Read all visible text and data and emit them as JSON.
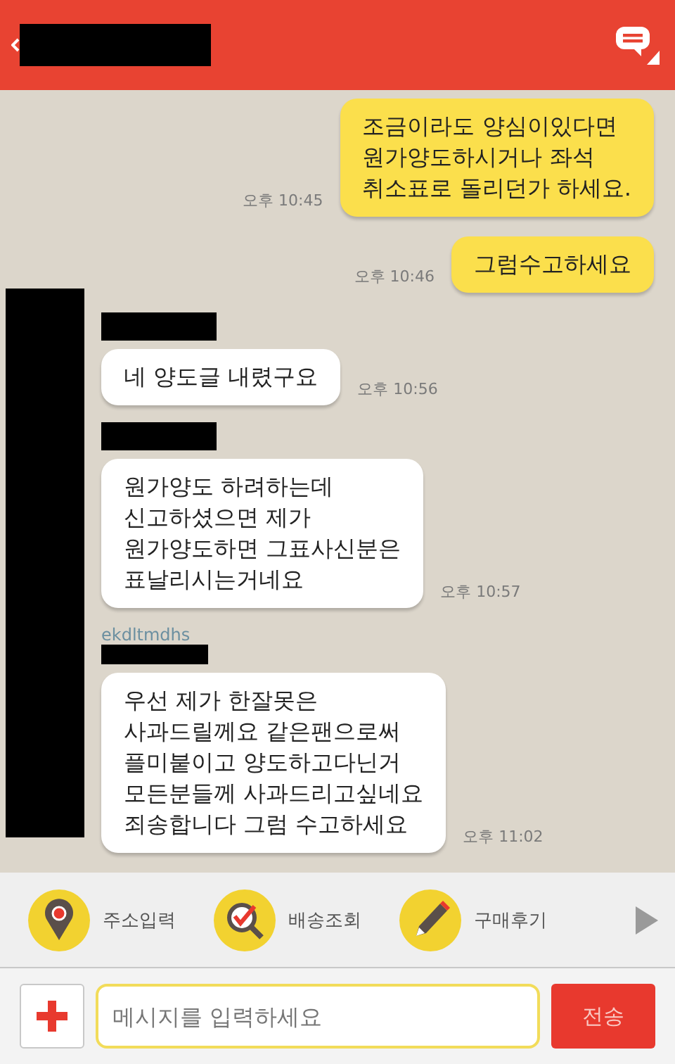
{
  "header": {
    "title_redacted": true
  },
  "chat": {
    "side_redacted": true,
    "messages": [
      {
        "kind": "outgoing",
        "lines": [
          "조금이라도 양심이있다면",
          "원가양도하시거나 좌석",
          "취소표로 돌리던가 하세요."
        ],
        "time": "오후 10:45"
      },
      {
        "kind": "outgoing",
        "lines": [
          "그럼수고하세요"
        ],
        "time": "오후 10:46"
      },
      {
        "kind": "incoming",
        "sender_redacted": true,
        "lines": [
          "네 양도글 내렸구요"
        ],
        "time": "오후 10:56"
      },
      {
        "kind": "incoming",
        "sender_redacted": true,
        "lines": [
          "원가양도 하려하는데",
          "신고하셨으면 제가",
          "원가양도하면 그표사신분은",
          "표날리시는거네요"
        ],
        "time": "오후 10:57"
      },
      {
        "kind": "incoming",
        "sender": "ekdltmdhs",
        "sender_redacted": true,
        "lines": [
          "우선 제가 한잘못은",
          "사과드릴께요 같은팬으로써",
          "플미붙이고 양도하고다닌거",
          "모든분들께 사과드리고싶네요",
          "죄송합니다 그럼 수고하세요"
        ],
        "time": "오후 11:02"
      }
    ]
  },
  "shortcuts": [
    {
      "kind": "pin",
      "label": "주소입력"
    },
    {
      "kind": "search-check",
      "label": "배송조회"
    },
    {
      "kind": "pencil",
      "label": "구매후기"
    }
  ],
  "composer": {
    "placeholder": "메시지를 입력하세요",
    "send": "전송"
  }
}
